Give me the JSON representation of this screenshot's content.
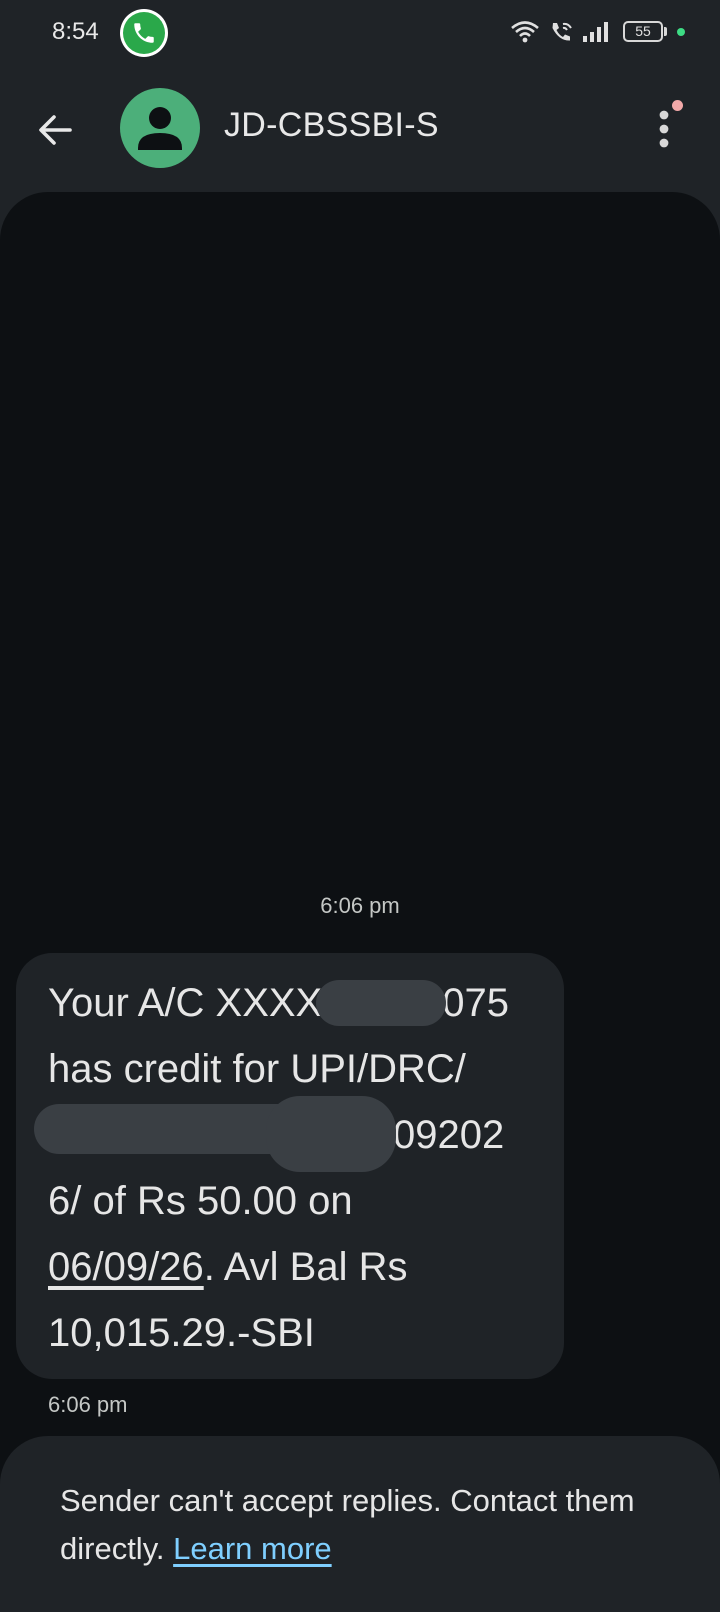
{
  "status_bar": {
    "time": "8:54",
    "battery_level": "55",
    "icons": [
      "whatsapp-icon",
      "wifi-icon",
      "wifi-calling-icon",
      "signal-icon",
      "battery-icon"
    ]
  },
  "toolbar": {
    "sender": "JD-CBSSBI-S",
    "icons": [
      "back-arrow-icon",
      "contact-avatar-icon",
      "more-vert-icon"
    ]
  },
  "conversation": {
    "date_divider": "6:06 pm",
    "message": {
      "line1": "Your A/C XXXX",
      "line1_end": "075",
      "line2": "has credit for UPI/DRC/",
      "line3_end": "09202",
      "line4": "6/ of Rs 50.00 on",
      "date": "06/09/26",
      "line5_rest": ". Avl Bal Rs",
      "line6": "10,015.29.-SBI",
      "time": "6:06 pm"
    }
  },
  "notice": {
    "text": "Sender can't accept replies. Contact them directly. ",
    "link": "Learn more"
  },
  "colors": {
    "background": "#1f2327",
    "conversation_bg": "#0d1013",
    "bubble": "#1f2327",
    "avatar": "#4caf7a",
    "link": "#7fcfff"
  }
}
